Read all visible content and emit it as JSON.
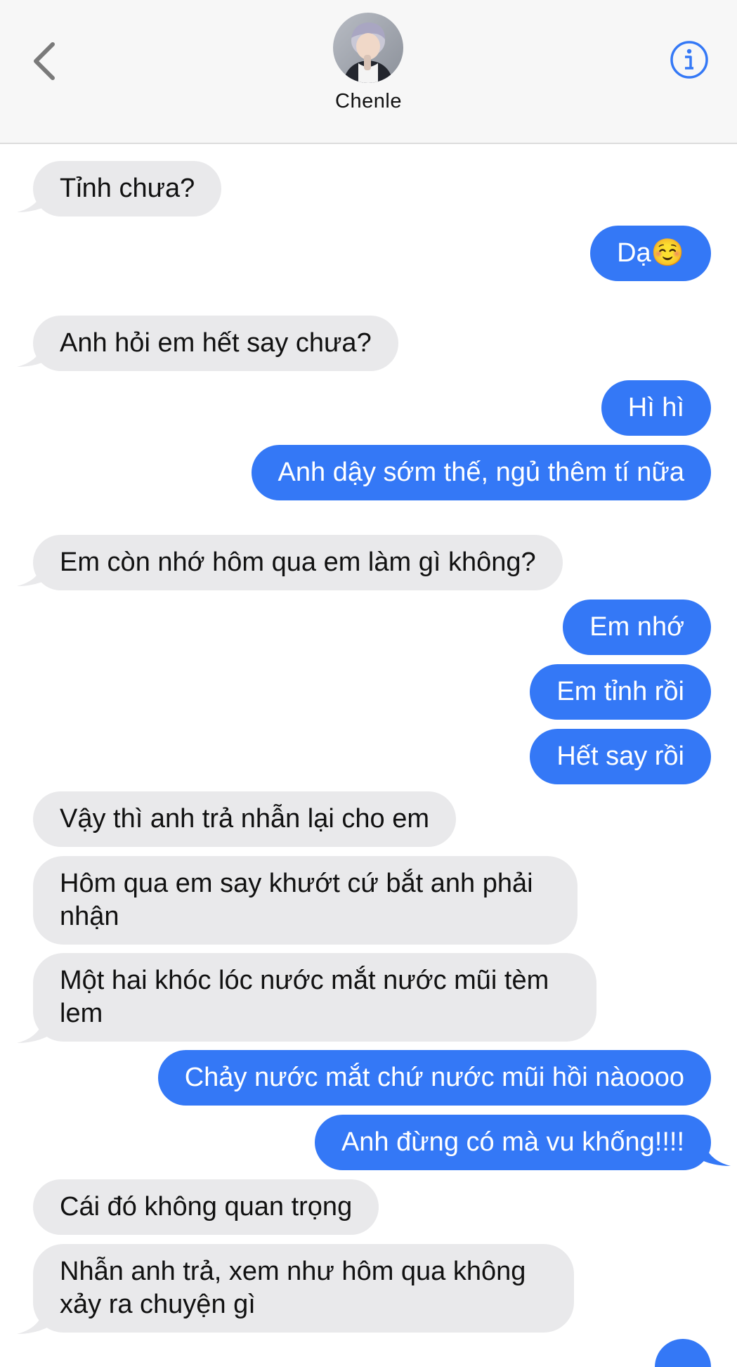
{
  "header": {
    "contact_name": "Chenle",
    "back_icon": "chevron-left-icon",
    "info_icon": "info-circle-icon"
  },
  "colors": {
    "sent_bubble": "#3478f6",
    "received_bubble": "#e9e9eb",
    "accent": "#3478f6"
  },
  "messages": [
    {
      "from": "received",
      "text": "Tỉnh chưa?"
    },
    {
      "from": "sent",
      "text": "Dạ☺️"
    },
    {
      "from": "received",
      "text": "Anh hỏi em hết say chưa?"
    },
    {
      "from": "sent",
      "text": "Hì hì"
    },
    {
      "from": "sent",
      "text": "Anh dậy sớm thế, ngủ thêm tí nữa"
    },
    {
      "from": "received",
      "text": "Em còn nhớ hôm qua em làm gì không?"
    },
    {
      "from": "sent",
      "text": "Em nhớ"
    },
    {
      "from": "sent",
      "text": "Em tỉnh rồi"
    },
    {
      "from": "sent",
      "text": "Hết say rồi"
    },
    {
      "from": "received",
      "text": "Vậy thì anh trả nhẫn lại cho em"
    },
    {
      "from": "received",
      "text": "Hôm qua em say khướt cứ bắt anh phải nhận"
    },
    {
      "from": "received",
      "text": "Một hai khóc lóc nước mắt nước mũi tèm lem"
    },
    {
      "from": "sent",
      "text": "Chảy nước mắt chứ nước mũi hồi nàoooo"
    },
    {
      "from": "sent",
      "text": "Anh đừng có mà vu khống!!!!"
    },
    {
      "from": "received",
      "text": "Cái đó không quan trọng"
    },
    {
      "from": "received",
      "text": "Nhẫn anh trả, xem như hôm qua không xảy ra chuyện gì"
    }
  ]
}
